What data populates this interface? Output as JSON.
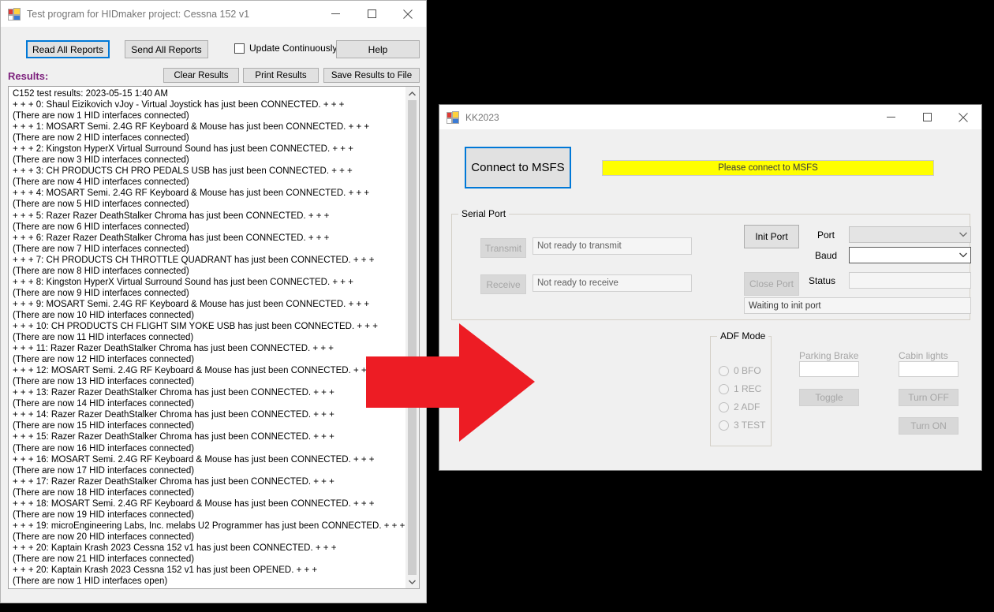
{
  "windows": {
    "hidmaker": {
      "title": "Test program for HIDmaker project: Cessna 152 v1",
      "icon": "app-window-icon",
      "minimize": "minimize-icon",
      "maximize": "maximize-icon",
      "close": "close-icon",
      "toolbar": {
        "read_all_reports": "Read All Reports",
        "send_all_reports": "Send All Reports",
        "update_continuously": "Update Continuously",
        "update_continuously_checked": false,
        "help": "Help"
      },
      "results_label": "Results:",
      "results_label_color": "#7d217d",
      "results_buttons": {
        "clear": "Clear Results",
        "print": "Print Results",
        "save": "Save Results to File"
      },
      "results_lines": [
        "C152 test results:  2023-05-15 1:40 AM",
        "+ + + 0: Shaul Eizikovich vJoy - Virtual Joystick has just been CONNECTED. + + +",
        "(There are now 1 HID interfaces connected)",
        "+ + + 1: MOSART Semi. 2.4G RF Keyboard & Mouse has just been CONNECTED. + + +",
        "(There are now 2 HID interfaces connected)",
        "+ + + 2: Kingston HyperX Virtual Surround Sound has just been CONNECTED. + + +",
        "(There are now 3 HID interfaces connected)",
        "+ + + 3: CH PRODUCTS CH PRO PEDALS USB  has just been CONNECTED. + + +",
        "(There are now 4 HID interfaces connected)",
        "+ + + 4: MOSART Semi. 2.4G RF Keyboard & Mouse has just been CONNECTED. + + +",
        "(There are now 5 HID interfaces connected)",
        "+ + + 5: Razer Razer DeathStalker Chroma has just been CONNECTED. + + +",
        "(There are now 6 HID interfaces connected)",
        "+ + + 6: Razer Razer DeathStalker Chroma has just been CONNECTED. + + +",
        "(There are now 7 HID interfaces connected)",
        "+ + + 7: CH PRODUCTS CH THROTTLE QUADRANT has just been CONNECTED. + + +",
        "(There are now 8 HID interfaces connected)",
        "+ + + 8: Kingston HyperX Virtual Surround Sound has just been CONNECTED. + + +",
        "(There are now 9 HID interfaces connected)",
        "+ + + 9: MOSART Semi. 2.4G RF Keyboard & Mouse has just been CONNECTED. + + +",
        "(There are now 10 HID interfaces connected)",
        "+ + + 10: CH PRODUCTS CH FLIGHT SIM YOKE USB  has just been CONNECTED. + + +",
        "(There are now 11 HID interfaces connected)",
        "+ + + 11: Razer Razer DeathStalker Chroma has just been CONNECTED. + + +",
        "(There are now 12 HID interfaces connected)",
        "+ + + 12: MOSART Semi. 2.4G RF Keyboard & Mouse has just been CONNECTED. + + +",
        "(There are now 13 HID interfaces connected)",
        "+ + + 13: Razer Razer DeathStalker Chroma has just been CONNECTED. + + +",
        "(There are now 14 HID interfaces connected)",
        "+ + + 14: Razer Razer DeathStalker Chroma has just been CONNECTED. + + +",
        "(There are now 15 HID interfaces connected)",
        "+ + + 15: Razer Razer DeathStalker Chroma has just been CONNECTED. + + +",
        "(There are now 16 HID interfaces connected)",
        "+ + + 16: MOSART Semi. 2.4G RF Keyboard & Mouse has just been CONNECTED. + + +",
        "(There are now 17 HID interfaces connected)",
        "+ + + 17: Razer Razer DeathStalker Chroma has just been CONNECTED. + + +",
        "(There are now 18 HID interfaces connected)",
        "+ + + 18: MOSART Semi. 2.4G RF Keyboard & Mouse has just been CONNECTED. + + +",
        "(There are now 19 HID interfaces connected)",
        "+ + + 19: microEngineering Labs, Inc. melabs U2 Programmer has just been CONNECTED. + + +",
        "(There are now 20 HID interfaces connected)",
        "+ + + 20: Kaptain Krash 2023 Cessna 152 v1 has just been CONNECTED. + + +",
        "(There are now 21 HID interfaces connected)",
        "+ + + 20: Kaptain Krash 2023 Cessna 152 v1 has just been OPENED. + + +",
        "(There are now 1 HID interfaces open)"
      ]
    },
    "kk2023": {
      "title": "KK2023",
      "connect_button": "Connect to MSFS",
      "status_banner": "Please connect to MSFS",
      "status_banner_color": "#ffff00",
      "serial_port": {
        "group_title": "Serial Port",
        "transmit_button": "Transmit",
        "transmit_field": "Not ready to transmit",
        "receive_button": "Receive",
        "receive_field": "Not ready to receive",
        "init_port_button": "Init Port",
        "close_port_button": "Close Port",
        "port_label": "Port",
        "port_value": "",
        "baud_label": "Baud",
        "baud_value": "",
        "status_label": "Status",
        "status_value": "",
        "waiting_field": "Waiting to init port"
      },
      "adf_mode": {
        "group_title": "ADF Mode",
        "options": [
          {
            "label": "0 BFO",
            "selected": false
          },
          {
            "label": "1 REC",
            "selected": false
          },
          {
            "label": "2 ADF",
            "selected": false
          },
          {
            "label": "3 TEST",
            "selected": false
          }
        ]
      },
      "parking_brake": {
        "label": "Parking Brake",
        "value": "",
        "toggle_button": "Toggle"
      },
      "cabin_lights": {
        "label": "Cabin lights",
        "value": "",
        "turn_off_button": "Turn OFF",
        "turn_on_button": "Turn ON"
      }
    }
  },
  "annotation": {
    "arrow": "right-arrow-annotation",
    "color": "#ed1c24"
  }
}
